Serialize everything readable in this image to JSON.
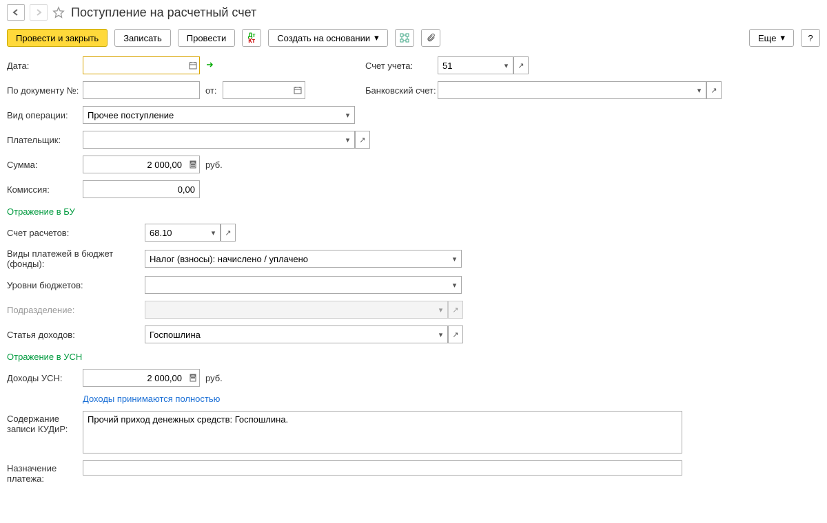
{
  "window": {
    "title": "Поступление на расчетный счет"
  },
  "toolbar": {
    "post_close": "Провести и закрыть",
    "write": "Записать",
    "post": "Провести",
    "create_based": "Создать на основании",
    "more": "Еще",
    "help": "?"
  },
  "labels": {
    "date": "Дата:",
    "account_of_record": "Счет учета:",
    "by_document_no": "По документу №:",
    "from": "от:",
    "bank_account": "Банковский счет:",
    "operation_type": "Вид операции:",
    "payer": "Плательщик:",
    "sum": "Сумма:",
    "commission": "Комиссия:",
    "currency": "руб.",
    "section_bu": "Отражение в БУ",
    "settlement_account": "Счет расчетов:",
    "budget_payment_types": "Виды платежей в бюджет (фонды):",
    "budget_levels": "Уровни бюджетов:",
    "department": "Подразделение:",
    "income_item": "Статья доходов:",
    "section_usn": "Отражение в УСН",
    "usn_income": "Доходы УСН:",
    "income_full_link": "Доходы принимаются полностью",
    "kudir_content": "Содержание записи КУДиР:",
    "payment_purpose": "Назначение платежа:"
  },
  "values": {
    "date": "",
    "account_of_record": "51",
    "doc_no": "",
    "doc_from": "",
    "bank_account": "",
    "operation_type": "Прочее поступление",
    "payer": "",
    "sum": "2 000,00",
    "commission": "0,00",
    "settlement_account": "68.10",
    "budget_payment_types": "Налог (взносы): начислено / уплачено",
    "budget_levels": "",
    "department": "",
    "income_item": "Госпошлина",
    "usn_income": "2 000,00",
    "kudir_content": "Прочий приход денежных средств: Госпошлина.",
    "payment_purpose": ""
  }
}
